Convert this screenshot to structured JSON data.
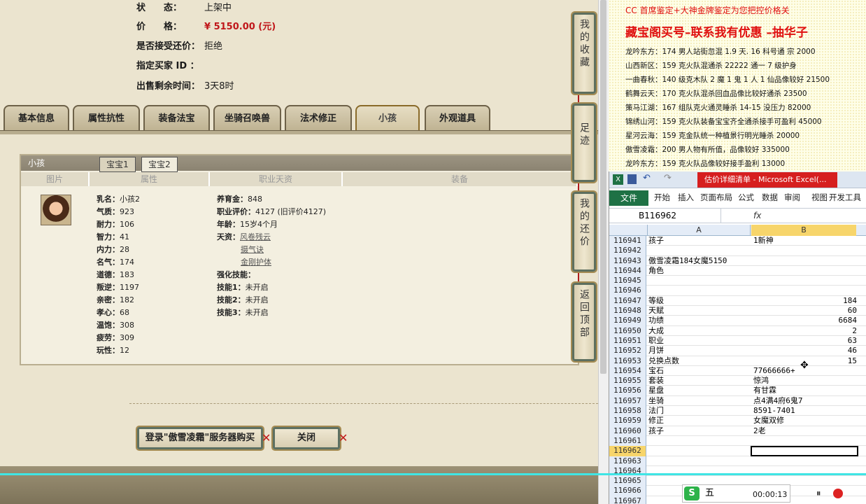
{
  "game": {
    "info": [
      {
        "label": "状　　态：",
        "value": "上架中"
      },
      {
        "label": "价　　格：",
        "value": "¥ 5150.00 (元)"
      },
      {
        "label": "是否接受还价：",
        "value": "拒绝"
      },
      {
        "label": "指定买家 ID ：",
        "value": ""
      },
      {
        "label": "出售剩余时间：",
        "value": "3天8时"
      }
    ],
    "tabs": [
      "基本信息",
      "属性抗性",
      "装备法宝",
      "坐骑召唤兽",
      "法术修正",
      "小孩",
      "外观道具"
    ],
    "active_tab": "小孩",
    "panel": {
      "title": "小孩",
      "subtabs": [
        "宝宝1",
        "宝宝2"
      ],
      "active_subtab": "宝宝2",
      "columns": [
        "图片",
        "属性",
        "职业天资",
        "装备"
      ],
      "stats_left": [
        {
          "k": "乳名：",
          "v": "小孩2"
        },
        {
          "k": "气质：",
          "v": "923"
        },
        {
          "k": "耐力：",
          "v": "106"
        },
        {
          "k": "智力：",
          "v": "41"
        },
        {
          "k": "内力：",
          "v": "28"
        },
        {
          "k": "名气：",
          "v": "174"
        },
        {
          "k": "道德：",
          "v": "183"
        },
        {
          "k": "叛逆：",
          "v": "1197"
        },
        {
          "k": "亲密：",
          "v": "182"
        },
        {
          "k": "孝心：",
          "v": "68"
        },
        {
          "k": "温饱：",
          "v": "308"
        },
        {
          "k": "疲劳：",
          "v": "309"
        },
        {
          "k": "玩性：",
          "v": "12"
        }
      ],
      "stats_right": [
        {
          "k": "养育金：",
          "v": "848"
        },
        {
          "k": "职业评价：",
          "v": "4127 (旧评价4127)"
        },
        {
          "k": "年龄：",
          "v": "15岁4个月"
        },
        {
          "k": "天资：",
          "v": "风卷残云"
        },
        {
          "k": "",
          "v": "摄气诀"
        },
        {
          "k": "",
          "v": "金刚护体"
        },
        {
          "k": "强化技能：",
          "v": ""
        },
        {
          "k": "技能1：",
          "v": "未开启"
        },
        {
          "k": "技能2：",
          "v": "未开启"
        },
        {
          "k": "技能3：",
          "v": "未开启"
        }
      ]
    },
    "side_buttons": [
      "我的收藏",
      "足迹",
      "我的还价",
      "返回顶部"
    ],
    "buy_button": "登录\"傲雪凌霜\"服务器购买",
    "close_button": "关闭"
  },
  "notes": {
    "line1": "CC 首席鉴定+大神金牌鉴定为您把控价格关",
    "headline": "藏宝阁买号–联系我有优惠 –抽华子",
    "lines": [
      "龙吟东方：174 男人站街忽混  1.9 天.  16 科号通 宗 2000",
      "山西新区：159 克火队混通杀 22222 通一 7 级护身",
      "一曲春秋：140 级克木队 2 魔 1 鬼 1 人 1 仙品像较好 21500",
      "鹤舞云天：170 克火队混杀回血品像比较好通杀 23500",
      "策马江湖：167 组队克火通灵睡杀 14-15 没压力 82000",
      "锦绣山河：159 克火队装备宝宝齐全通杀接手可盈利 45000",
      "星河云海：159 克金队统一种植景行明光睡杀 20000",
      "傲雪凌霜：200 男人物有所值，品像较好 335000",
      "龙吟东方：159 克火队品像较好接手盈利 13000"
    ]
  },
  "excel": {
    "title": "估价详细清单 - Microsoft Excel(...",
    "file_tab": "文件",
    "ribbon_tabs": [
      "开始",
      "插入",
      "页面布局",
      "公式",
      "数据",
      "审阅",
      "视图",
      "开发工具"
    ],
    "namebox": "B116962",
    "fx": "fx",
    "col_a": "A",
    "col_b": "B",
    "rows": [
      {
        "n": "116941",
        "a": "孩子",
        "b": "1新神",
        "num": false
      },
      {
        "n": "116942",
        "a": "",
        "b": "",
        "num": false
      },
      {
        "n": "116943",
        "a": "傲雪凌霜184女魔5150",
        "b": "",
        "num": false
      },
      {
        "n": "116944",
        "a": "角色",
        "b": "",
        "num": false
      },
      {
        "n": "116945",
        "a": "",
        "b": "",
        "num": false
      },
      {
        "n": "116946",
        "a": "",
        "b": "",
        "num": false
      },
      {
        "n": "116947",
        "a": "等级",
        "b": "184",
        "num": true
      },
      {
        "n": "116948",
        "a": "天赋",
        "b": "60",
        "num": true
      },
      {
        "n": "116949",
        "a": "功绩",
        "b": "6684",
        "num": true
      },
      {
        "n": "116950",
        "a": "大成",
        "b": "2",
        "num": true
      },
      {
        "n": "116951",
        "a": "职业",
        "b": "63",
        "num": true
      },
      {
        "n": "116952",
        "a": "月饼",
        "b": "46",
        "num": true
      },
      {
        "n": "116953",
        "a": "兑换点数",
        "b": "15",
        "num": true
      },
      {
        "n": "116954",
        "a": "宝石",
        "b": "77666666+",
        "num": false
      },
      {
        "n": "116955",
        "a": "套装",
        "b": "惊鸿",
        "num": false
      },
      {
        "n": "116956",
        "a": "星盘",
        "b": "有甘霖",
        "num": false
      },
      {
        "n": "116957",
        "a": "坐骑",
        "b": "点4满4府6鬼7",
        "num": false
      },
      {
        "n": "116958",
        "a": "法门",
        "b": "8591-7401",
        "num": false
      },
      {
        "n": "116959",
        "a": "修正",
        "b": "女魔双修",
        "num": false
      },
      {
        "n": "116960",
        "a": "孩子",
        "b": "2老",
        "num": false
      },
      {
        "n": "116961",
        "a": "",
        "b": "",
        "num": false
      },
      {
        "n": "116962",
        "a": "",
        "b": "",
        "num": false,
        "sel": true
      },
      {
        "n": "116963",
        "a": "",
        "b": "",
        "num": false
      },
      {
        "n": "116964",
        "a": "",
        "b": "",
        "num": false
      },
      {
        "n": "116965",
        "a": "",
        "b": "",
        "num": false
      },
      {
        "n": "116966",
        "a": "",
        "b": "",
        "num": false
      },
      {
        "n": "116967",
        "a": "",
        "b": "",
        "num": false
      }
    ]
  },
  "taskbar": {
    "ime": "五",
    "timer": "00:00:13"
  }
}
